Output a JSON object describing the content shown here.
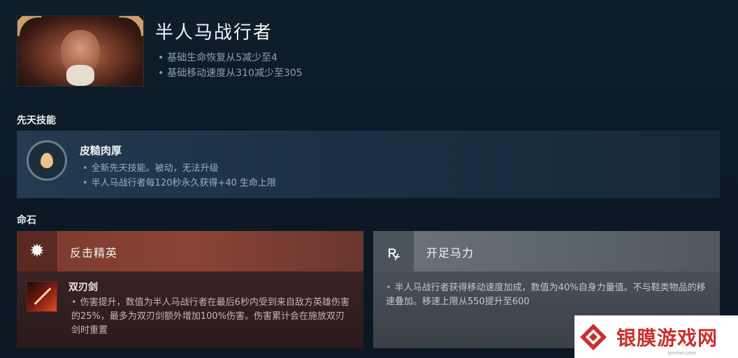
{
  "hero": {
    "name": "半人马战行者",
    "changes": [
      "基础生命恢复从5减少至4",
      "基础移动速度从310减少至305"
    ]
  },
  "innate": {
    "section_title": "先天技能",
    "ability_name": "皮糙肉厚",
    "notes": [
      "全新先天技能。被动，无法升级",
      "半人马战行者每120秒永久获得+40 生命上限"
    ]
  },
  "facets": {
    "section_title": "命石",
    "left": {
      "label": "反击精英",
      "item_name": "双刃剑",
      "item_desc": "伤害提升，数值为半人马战行者在最后6秒内受到来自敌方英雄伤害的25%，最多为双刃剑额外增加100%伤害。伤害累计会在施放双刃剑时重置"
    },
    "right": {
      "label": "开足马力",
      "desc": "半人马战行者获得移动速度加成，数值为40%自身力量值。不与鞋类物品的移速叠加。移速上限从550提升至600"
    }
  },
  "watermark": {
    "text": "银膜游戏网",
    "sub": "iyinmn.com"
  }
}
